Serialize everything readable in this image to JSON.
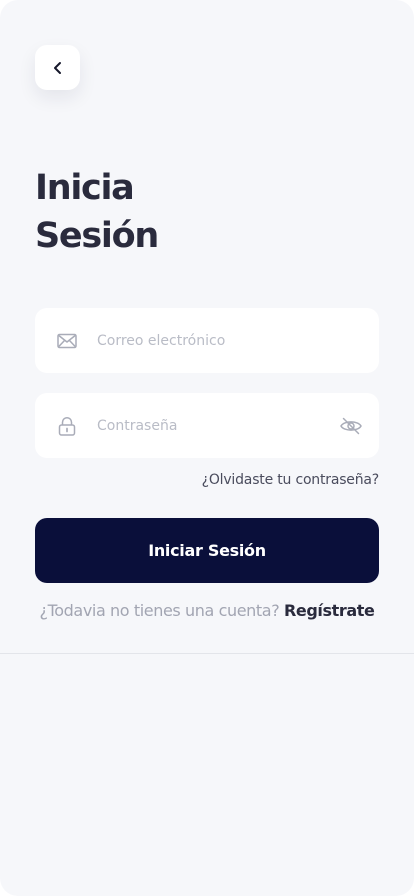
{
  "header": {
    "back_icon": "chevron-left-icon"
  },
  "title": {
    "line1": "Inicia",
    "line2": "Sesión"
  },
  "form": {
    "email": {
      "icon": "mail-icon",
      "placeholder": "Correo electrónico",
      "value": ""
    },
    "password": {
      "icon": "lock-icon",
      "placeholder": "Contraseña",
      "value": "",
      "toggle_icon": "eye-off-icon"
    },
    "forgot_label": "¿Olvidaste tu contraseña?",
    "submit_label": "Iniciar Sesión"
  },
  "signup": {
    "prompt": "¿Todavia no tienes una cuenta?",
    "link_label": "Regístrate"
  },
  "colors": {
    "background": "#f6f7fa",
    "primary": "#0a0f3a",
    "heading": "#2a2b3d",
    "muted": "#a2a5b2",
    "placeholder": "#b9bcc6"
  }
}
